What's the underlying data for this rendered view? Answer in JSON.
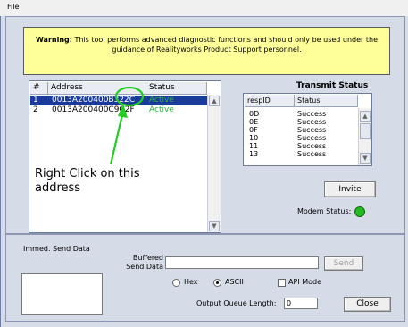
{
  "menu": {
    "file": "File"
  },
  "warning": {
    "label": "Warning:",
    "text": "This tool performs advanced diagnostic functions and should only be used under the guidance of Realityworks Product Support personnel."
  },
  "address_list": {
    "columns": [
      "#",
      "Address",
      "Status"
    ],
    "rows": [
      {
        "num": "1",
        "address": "0013A200400B322C",
        "status": "Active",
        "selected": true
      },
      {
        "num": "2",
        "address": "0013A200400C9C2F",
        "status": "Active",
        "selected": false
      }
    ]
  },
  "transmit_status": {
    "title": "Transmit Status",
    "columns": [
      "respID",
      "Status"
    ],
    "rows": [
      {
        "resp_id": "0D",
        "status": "Success"
      },
      {
        "resp_id": "0E",
        "status": "Success"
      },
      {
        "resp_id": "0F",
        "status": "Success"
      },
      {
        "resp_id": "10",
        "status": "Success"
      },
      {
        "resp_id": "11",
        "status": "Success"
      },
      {
        "resp_id": "13",
        "status": "Success"
      }
    ]
  },
  "annotation": {
    "text_line1": "Right Click on this",
    "text_line2": "address",
    "color": "#22cc22"
  },
  "invite_button": "Invite",
  "modem_status": {
    "label": "Modem Status:",
    "color": "#22bb22"
  },
  "immed_send": {
    "label": "Immed. Send Data"
  },
  "buffered_send": {
    "label_line1": "Buffered",
    "label_line2": "Send Data",
    "value": "",
    "send_button": "Send"
  },
  "format": {
    "hex_label": "Hex",
    "ascii_label": "ASCII",
    "selected": "ASCII"
  },
  "api_mode": {
    "label": "API Mode",
    "checked": false
  },
  "output_queue": {
    "label": "Output Queue Length:",
    "value": "0"
  },
  "close_button": "Close"
}
